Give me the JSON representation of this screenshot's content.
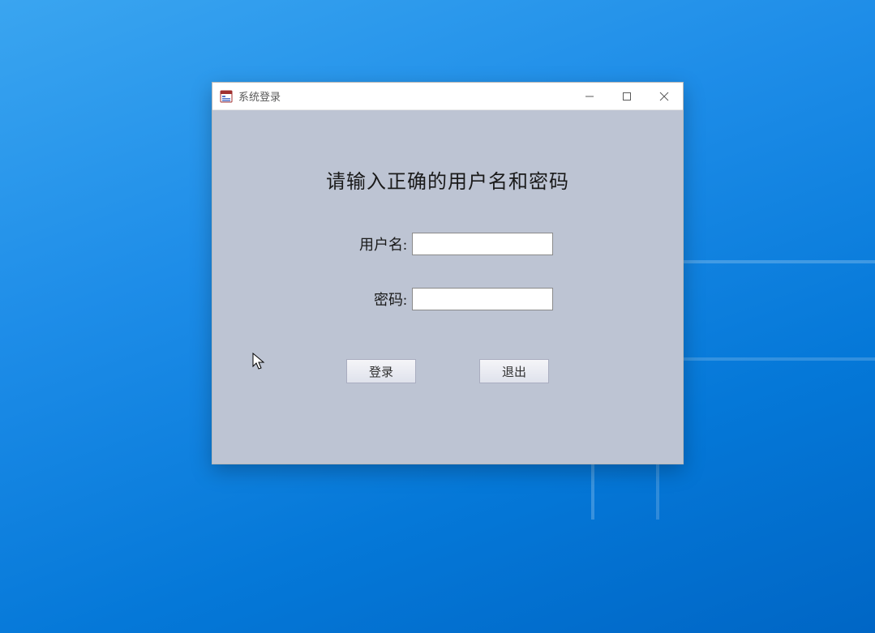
{
  "window": {
    "title": "系统登录"
  },
  "form": {
    "heading": "请输入正确的用户名和密码",
    "username_label": "用户名:",
    "username_value": "",
    "password_label": "密码:",
    "password_value": ""
  },
  "buttons": {
    "login": "登录",
    "exit": "退出"
  }
}
